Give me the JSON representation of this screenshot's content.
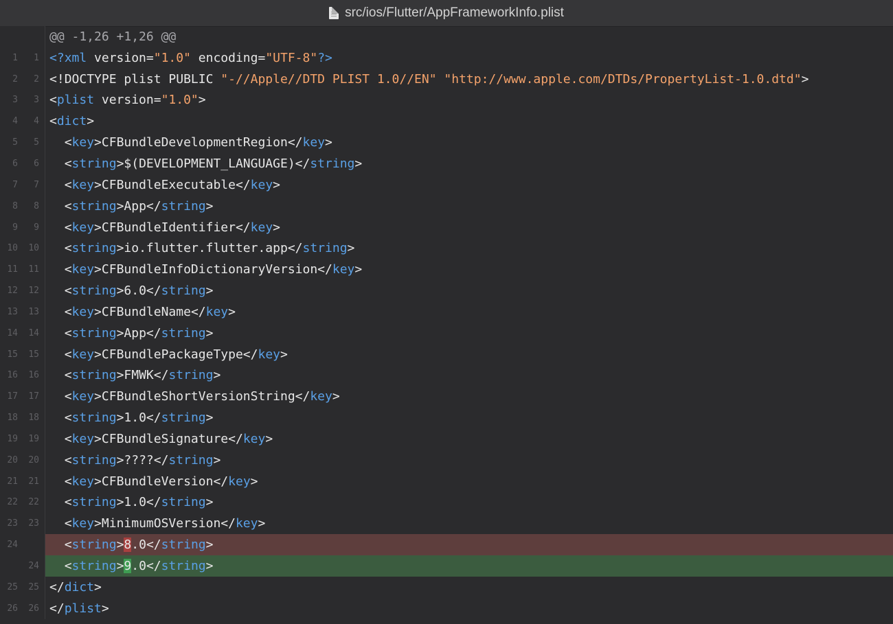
{
  "window": {
    "title": "src/ios/Flutter/AppFrameworkInfo.plist",
    "title_icon": "document-icon"
  },
  "colors": {
    "background": "#2b2b2d",
    "removed_line": "#5e3e3d",
    "added_line": "#3b5c3f",
    "removed_char": "#a8403f",
    "added_char": "#3f9c52",
    "tag": "#5aa0e6",
    "attribute": "#ff6b8a",
    "string_value": "#f5a36b"
  },
  "diff": {
    "hunk_header": "@@ -1,26 +1,26 @@",
    "lines": [
      {
        "old": "1",
        "new": "1",
        "type": "context",
        "code": "<?xml version=\"1.0\" encoding=\"UTF-8\"?>"
      },
      {
        "old": "2",
        "new": "2",
        "type": "context",
        "code": "<!DOCTYPE plist PUBLIC \"-//Apple//DTD PLIST 1.0//EN\" \"http://www.apple.com/DTDs/PropertyList-1.0.dtd\">"
      },
      {
        "old": "3",
        "new": "3",
        "type": "context",
        "code": "<plist version=\"1.0\">"
      },
      {
        "old": "4",
        "new": "4",
        "type": "context",
        "code": "<dict>"
      },
      {
        "old": "5",
        "new": "5",
        "type": "context",
        "code": "  <key>CFBundleDevelopmentRegion</key>"
      },
      {
        "old": "6",
        "new": "6",
        "type": "context",
        "code": "  <string>$(DEVELOPMENT_LANGUAGE)</string>"
      },
      {
        "old": "7",
        "new": "7",
        "type": "context",
        "code": "  <key>CFBundleExecutable</key>"
      },
      {
        "old": "8",
        "new": "8",
        "type": "context",
        "code": "  <string>App</string>"
      },
      {
        "old": "9",
        "new": "9",
        "type": "context",
        "code": "  <key>CFBundleIdentifier</key>"
      },
      {
        "old": "10",
        "new": "10",
        "type": "context",
        "code": "  <string>io.flutter.flutter.app</string>"
      },
      {
        "old": "11",
        "new": "11",
        "type": "context",
        "code": "  <key>CFBundleInfoDictionaryVersion</key>"
      },
      {
        "old": "12",
        "new": "12",
        "type": "context",
        "code": "  <string>6.0</string>"
      },
      {
        "old": "13",
        "new": "13",
        "type": "context",
        "code": "  <key>CFBundleName</key>"
      },
      {
        "old": "14",
        "new": "14",
        "type": "context",
        "code": "  <string>App</string>"
      },
      {
        "old": "15",
        "new": "15",
        "type": "context",
        "code": "  <key>CFBundlePackageType</key>"
      },
      {
        "old": "16",
        "new": "16",
        "type": "context",
        "code": "  <string>FMWK</string>"
      },
      {
        "old": "17",
        "new": "17",
        "type": "context",
        "code": "  <key>CFBundleShortVersionString</key>"
      },
      {
        "old": "18",
        "new": "18",
        "type": "context",
        "code": "  <string>1.0</string>"
      },
      {
        "old": "19",
        "new": "19",
        "type": "context",
        "code": "  <key>CFBundleSignature</key>"
      },
      {
        "old": "20",
        "new": "20",
        "type": "context",
        "code": "  <string>????</string>"
      },
      {
        "old": "21",
        "new": "21",
        "type": "context",
        "code": "  <key>CFBundleVersion</key>"
      },
      {
        "old": "22",
        "new": "22",
        "type": "context",
        "code": "  <string>1.0</string>"
      },
      {
        "old": "23",
        "new": "23",
        "type": "context",
        "code": "  <key>MinimumOSVersion</key>"
      },
      {
        "old": "24",
        "new": "",
        "type": "removed",
        "code": "  <string>8.0</string>",
        "changed_char": 10
      },
      {
        "old": "",
        "new": "24",
        "type": "added",
        "code": "  <string>9.0</string>",
        "changed_char": 10
      },
      {
        "old": "25",
        "new": "25",
        "type": "context",
        "code": "</dict>"
      },
      {
        "old": "26",
        "new": "26",
        "type": "context",
        "code": "</plist>"
      }
    ]
  }
}
